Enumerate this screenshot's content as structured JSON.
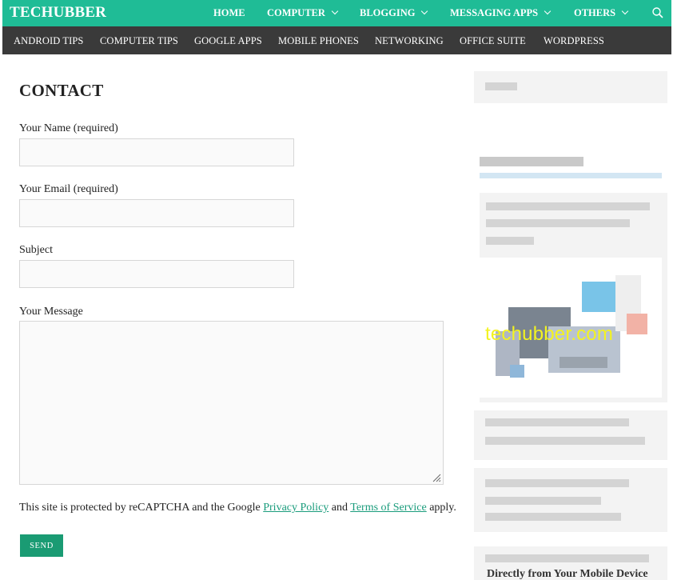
{
  "site": {
    "logo": "TECHUBBER"
  },
  "top_nav": [
    {
      "label": "HOME",
      "has_dropdown": false
    },
    {
      "label": "COMPUTER",
      "has_dropdown": true
    },
    {
      "label": "BLOGGING",
      "has_dropdown": true
    },
    {
      "label": "MESSAGING APPS",
      "has_dropdown": true
    },
    {
      "label": "OTHERS",
      "has_dropdown": true
    }
  ],
  "sub_nav": [
    "ANDROID TIPS",
    "COMPUTER TIPS",
    "GOOGLE APPS",
    "MOBILE PHONES",
    "NETWORKING",
    "OFFICE SUITE",
    "WORDPRESS"
  ],
  "page": {
    "title": "CONTACT"
  },
  "form": {
    "name_label": "Your Name (required)",
    "name_value": "",
    "email_label": "Your Email (required)",
    "email_value": "",
    "subject_label": "Subject",
    "subject_value": "",
    "message_label": "Your Message",
    "message_value": "",
    "send_label": "SEND"
  },
  "recaptcha_notice": {
    "prefix": "This site is protected by reCAPTCHA and the Google ",
    "privacy_link": "Privacy Policy",
    "middle": " and ",
    "terms_link": "Terms of Service",
    "suffix": " apply."
  },
  "sidebar": {
    "image_watermark": "techubber.com",
    "cutoff_text": "Directly from Your Mobile Device"
  },
  "colors": {
    "topbar": "#1fbc96",
    "subbar": "#3a3a3a",
    "send_button": "#1a9b73",
    "link": "#1a9c7c",
    "watermark": "#f3f320"
  },
  "icons": {
    "search": "search-icon",
    "dropdown": "chevron-down-icon",
    "resize": "resize-grip-icon"
  }
}
